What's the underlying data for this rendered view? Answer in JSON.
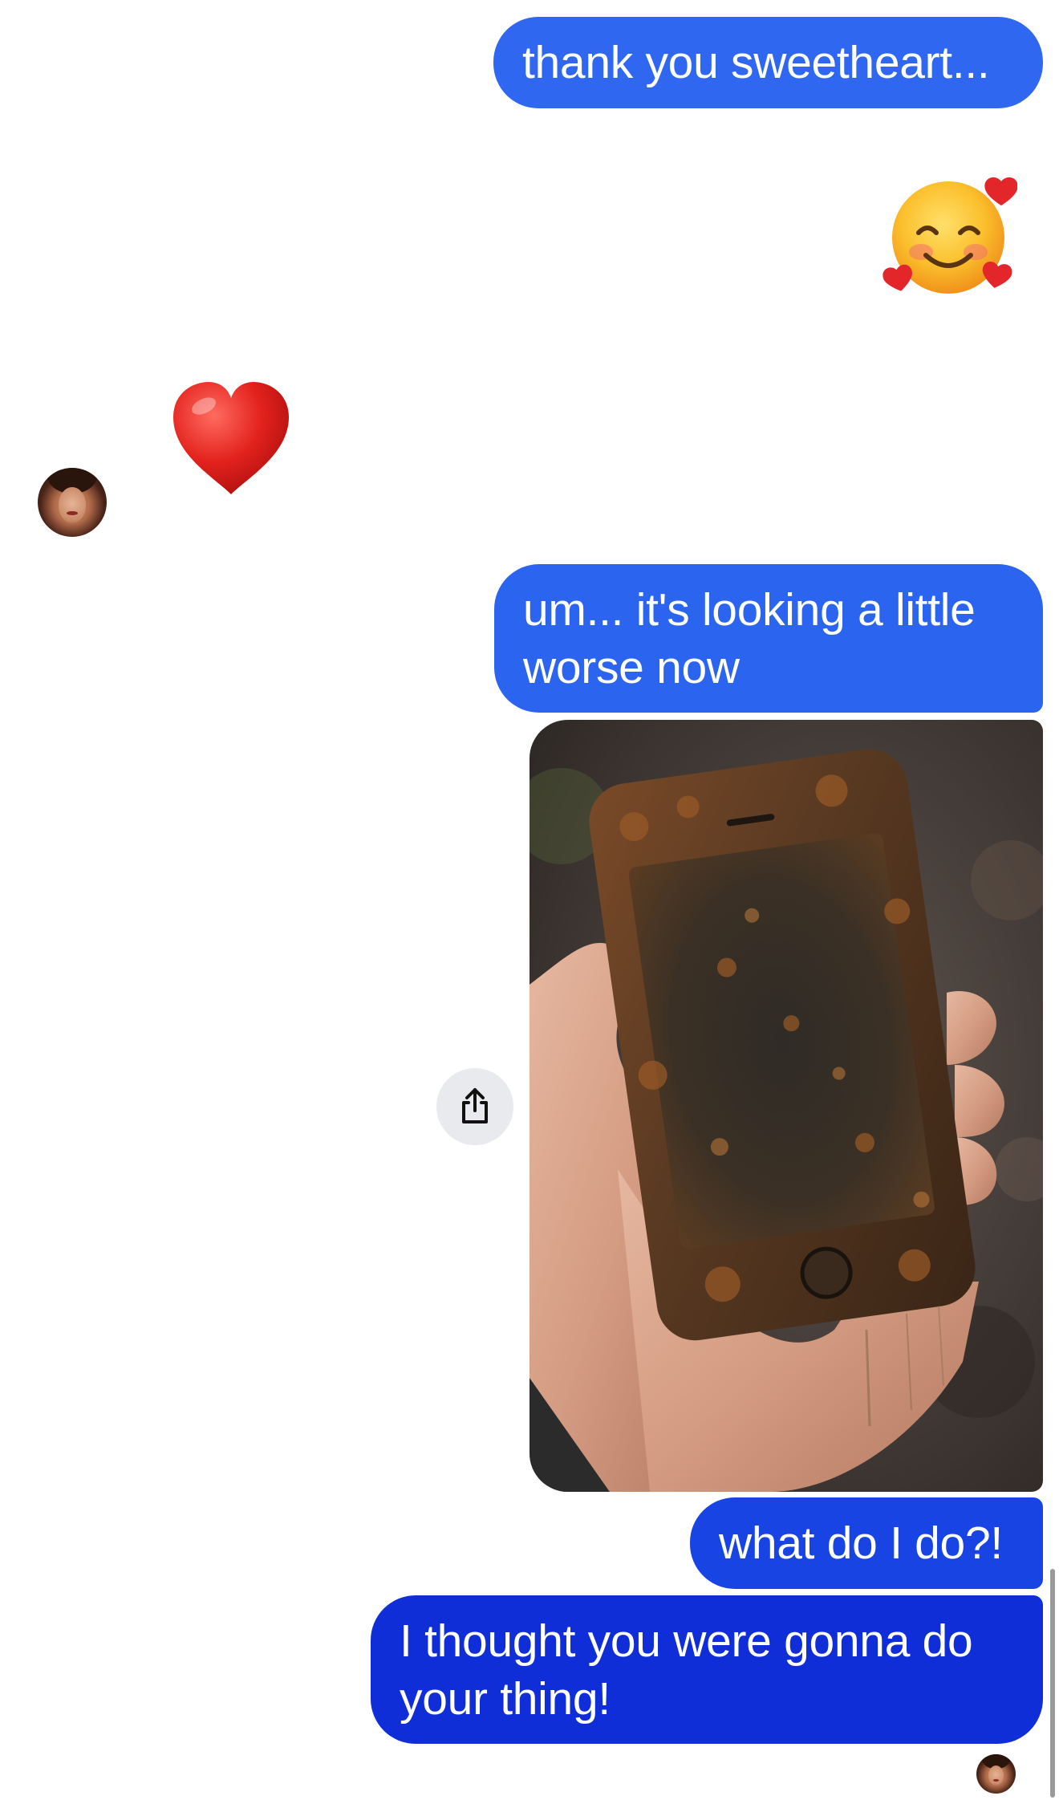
{
  "conversation": {
    "messages": [
      {
        "sender": "me",
        "type": "text",
        "lines": [
          "thank you sweetheart..."
        ]
      },
      {
        "sender": "me",
        "type": "emoji",
        "emoji": "smiling-face-with-hearts-icon"
      },
      {
        "sender": "contact",
        "type": "emoji",
        "emoji": "red-heart-icon"
      },
      {
        "sender": "me",
        "type": "text",
        "lines": [
          "um... it's looking a little",
          "worse now"
        ]
      },
      {
        "sender": "me",
        "type": "image",
        "content": "photo-of-muddy-rusted-phone"
      },
      {
        "sender": "me",
        "type": "text",
        "lines": [
          "what do I do?!"
        ]
      },
      {
        "sender": "me",
        "type": "text",
        "lines": [
          "I thought you were gonna do",
          "your thing!"
        ]
      }
    ]
  },
  "actions": {
    "share_icon": "share-icon"
  },
  "colors": {
    "bubble_top": "#2f67f1",
    "bubble_mid": "#1744e3",
    "bubble_bottom": "#0f2ed8",
    "share_button_bg": "#e9eaed",
    "heart": "#e0201e",
    "emoji_face": "#f9b926"
  }
}
